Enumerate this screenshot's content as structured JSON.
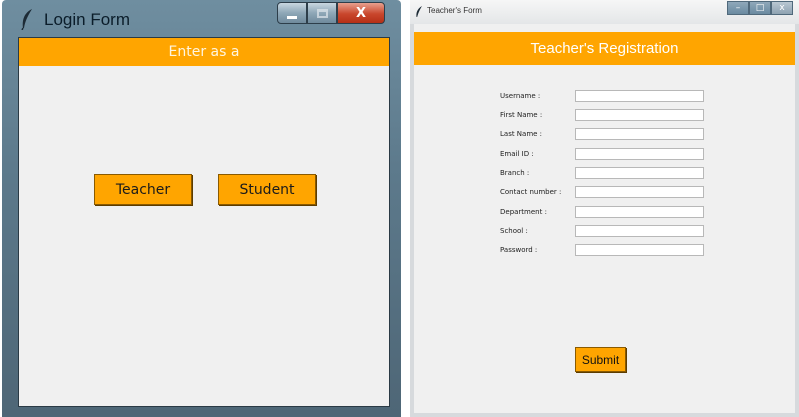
{
  "login_window": {
    "title": "Login Form",
    "controls": {
      "minimize_icon": "minimize-icon",
      "maximize_icon": "maximize-icon",
      "close_icon": "close-icon",
      "close_label": "X"
    },
    "banner_text": "Enter as a",
    "teacher_button": "Teacher",
    "student_button": "Student",
    "colors": {
      "accent": "#ffa500",
      "client_bg": "#f0f0f0",
      "close": "#c9462c"
    }
  },
  "teacher_window": {
    "title": "Teacher's Form",
    "controls": {
      "minimize_label": "–",
      "maximize_label": "□",
      "close_label": "x"
    },
    "heading": "Teacher's Registration",
    "fields": [
      {
        "label": "Username :",
        "value": ""
      },
      {
        "label": "First Name :",
        "value": ""
      },
      {
        "label": "Last Name :",
        "value": ""
      },
      {
        "label": "Email ID :",
        "value": ""
      },
      {
        "label": "Branch :",
        "value": ""
      },
      {
        "label": "Contact number :",
        "value": ""
      },
      {
        "label": "Department :",
        "value": ""
      },
      {
        "label": "School :",
        "value": ""
      },
      {
        "label": "Password :",
        "value": ""
      }
    ],
    "submit_button": "Submit",
    "colors": {
      "accent": "#ffa500",
      "client_bg": "#f0f0f0"
    }
  }
}
